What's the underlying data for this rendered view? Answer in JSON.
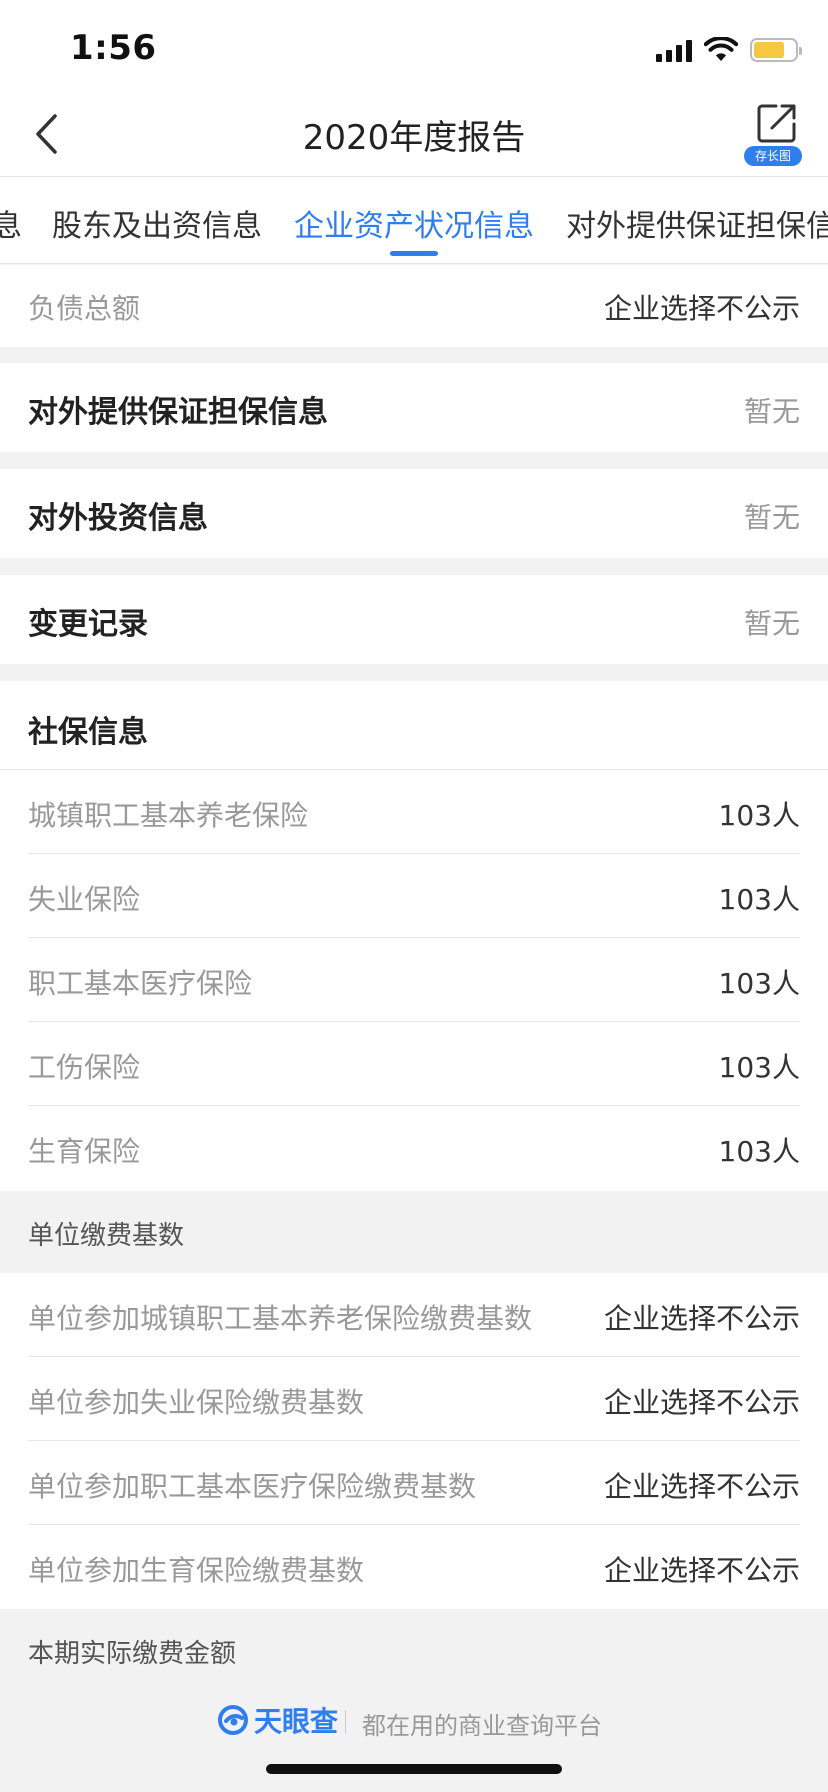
{
  "status_bar": {
    "time": "1:56"
  },
  "nav": {
    "title": "2020年度报告",
    "share_label": "存长图"
  },
  "tabs": [
    {
      "label": "息"
    },
    {
      "label": "股东及出资信息"
    },
    {
      "label": "企业资产状况信息"
    },
    {
      "label": "对外提供保证担保信"
    }
  ],
  "assets": {
    "label": "负债总额",
    "value": "企业选择不公示"
  },
  "guarantee": {
    "title": "对外提供保证担保信息",
    "value": "暂无"
  },
  "investment": {
    "title": "对外投资信息",
    "value": "暂无"
  },
  "changes": {
    "title": "变更记录",
    "value": "暂无"
  },
  "social": {
    "title": "社保信息",
    "items": [
      {
        "label": "城镇职工基本养老保险",
        "value": "103人"
      },
      {
        "label": "失业保险",
        "value": "103人"
      },
      {
        "label": "职工基本医疗保险",
        "value": "103人"
      },
      {
        "label": "工伤保险",
        "value": "103人"
      },
      {
        "label": "生育保险",
        "value": "103人"
      }
    ]
  },
  "base": {
    "title": "单位缴费基数",
    "items": [
      {
        "label": "单位参加城镇职工基本养老保险缴费基数",
        "value": "企业选择不公示"
      },
      {
        "label": "单位参加失业保险缴费基数",
        "value": "企业选择不公示"
      },
      {
        "label": "单位参加职工基本医疗保险缴费基数",
        "value": "企业选择不公示"
      },
      {
        "label": "单位参加生育保险缴费基数",
        "value": "企业选择不公示"
      }
    ]
  },
  "actual": {
    "title": "本期实际缴费金额"
  },
  "footer": {
    "brand": "天眼查",
    "slogan": "都在用的商业查询平台"
  },
  "colors": {
    "accent": "#2f7ef0",
    "battery": "#f5c842"
  }
}
